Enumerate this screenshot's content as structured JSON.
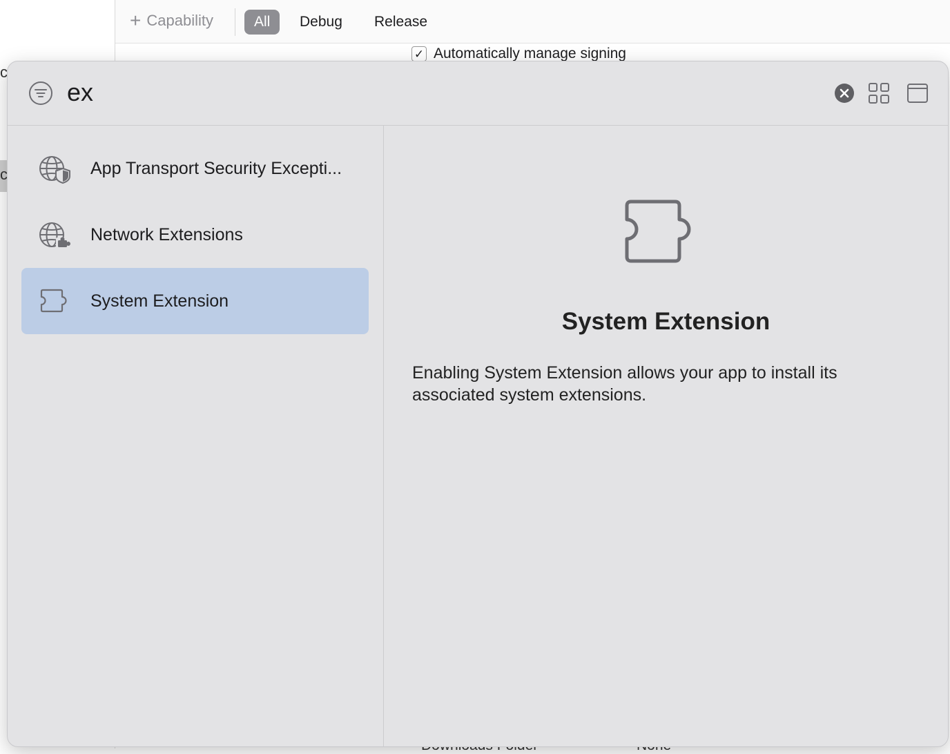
{
  "background": {
    "add_capability": "Capability",
    "segments": [
      "All",
      "Debug",
      "Release"
    ],
    "auto_signing_label": "Automatically manage signing",
    "left_fragments": [
      "ca",
      "ca"
    ],
    "bottom_fragments": [
      "Downloads Folder",
      "None"
    ]
  },
  "popover": {
    "search_value": "ex",
    "items": [
      {
        "label": "App Transport Security Excepti...",
        "icon": "globe-shield-icon"
      },
      {
        "label": "Network Extensions",
        "icon": "globe-puzzle-icon"
      },
      {
        "label": "System Extension",
        "icon": "puzzle-piece-icon",
        "selected": true
      }
    ],
    "detail": {
      "icon": "puzzle-piece-icon",
      "title": "System Extension",
      "description": "Enabling System Extension allows your app to install its associated system extensions."
    },
    "colors": {
      "selection": "#bccde6",
      "panel": "#e3e3e5"
    }
  }
}
